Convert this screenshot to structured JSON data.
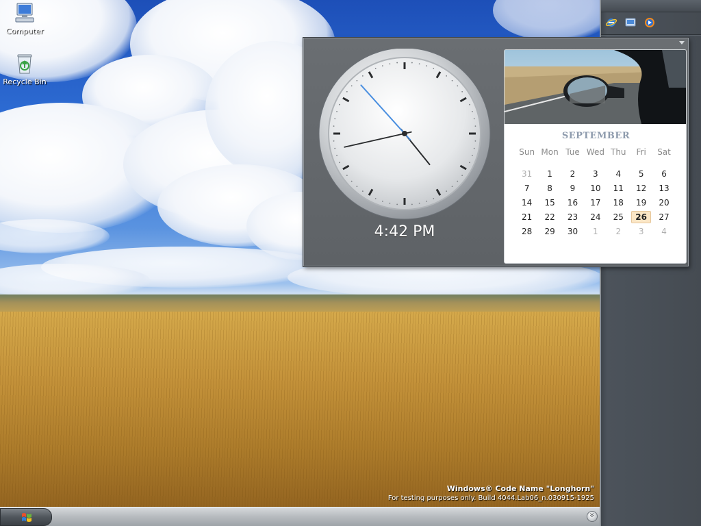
{
  "desktop": {
    "icons": [
      {
        "label": "Computer",
        "icon": "computer-icon"
      },
      {
        "label": "Recycle Bin",
        "icon": "recycle-bin-icon"
      }
    ],
    "watermark": {
      "title": "Windows® Code Name \"Longhorn\"",
      "build": "For testing purposes only. Build 4044.Lab06_n.030915-1925"
    }
  },
  "sidebar": {
    "quick_launch": [
      {
        "icon": "internet-explorer-icon"
      },
      {
        "icon": "show-desktop-icon"
      },
      {
        "icon": "media-player-icon"
      }
    ]
  },
  "clock": {
    "time_text": "4:42 PM",
    "hour": 4,
    "minute": 42,
    "second": 53
  },
  "calendar": {
    "month": "SEPTEMBER",
    "weekdays": [
      "Sun",
      "Mon",
      "Tue",
      "Wed",
      "Thu",
      "Fri",
      "Sat"
    ],
    "today": 26,
    "weeks": [
      [
        {
          "d": "31",
          "dim": true
        },
        {
          "d": "1"
        },
        {
          "d": "2"
        },
        {
          "d": "3"
        },
        {
          "d": "4"
        },
        {
          "d": "5"
        },
        {
          "d": "6"
        }
      ],
      [
        {
          "d": "7"
        },
        {
          "d": "8"
        },
        {
          "d": "9"
        },
        {
          "d": "10"
        },
        {
          "d": "11"
        },
        {
          "d": "12"
        },
        {
          "d": "13"
        }
      ],
      [
        {
          "d": "14"
        },
        {
          "d": "15"
        },
        {
          "d": "16"
        },
        {
          "d": "17"
        },
        {
          "d": "18"
        },
        {
          "d": "19"
        },
        {
          "d": "20"
        }
      ],
      [
        {
          "d": "21"
        },
        {
          "d": "22"
        },
        {
          "d": "23"
        },
        {
          "d": "24"
        },
        {
          "d": "25"
        },
        {
          "d": "26",
          "today": true
        },
        {
          "d": "27"
        }
      ],
      [
        {
          "d": "28"
        },
        {
          "d": "29"
        },
        {
          "d": "30"
        },
        {
          "d": "1",
          "dim": true
        },
        {
          "d": "2",
          "dim": true
        },
        {
          "d": "3",
          "dim": true
        },
        {
          "d": "4",
          "dim": true
        }
      ]
    ]
  },
  "taskbar": {
    "start_icon": "windows-flag-icon",
    "tray_icon": "chevron-down-icon"
  },
  "colors": {
    "sidebar": "#454b52",
    "panel": "#64686c",
    "taskbar": "#b9bdc1",
    "calendar_today": "#fbe6c6",
    "second_hand": "#4a8fe0"
  }
}
